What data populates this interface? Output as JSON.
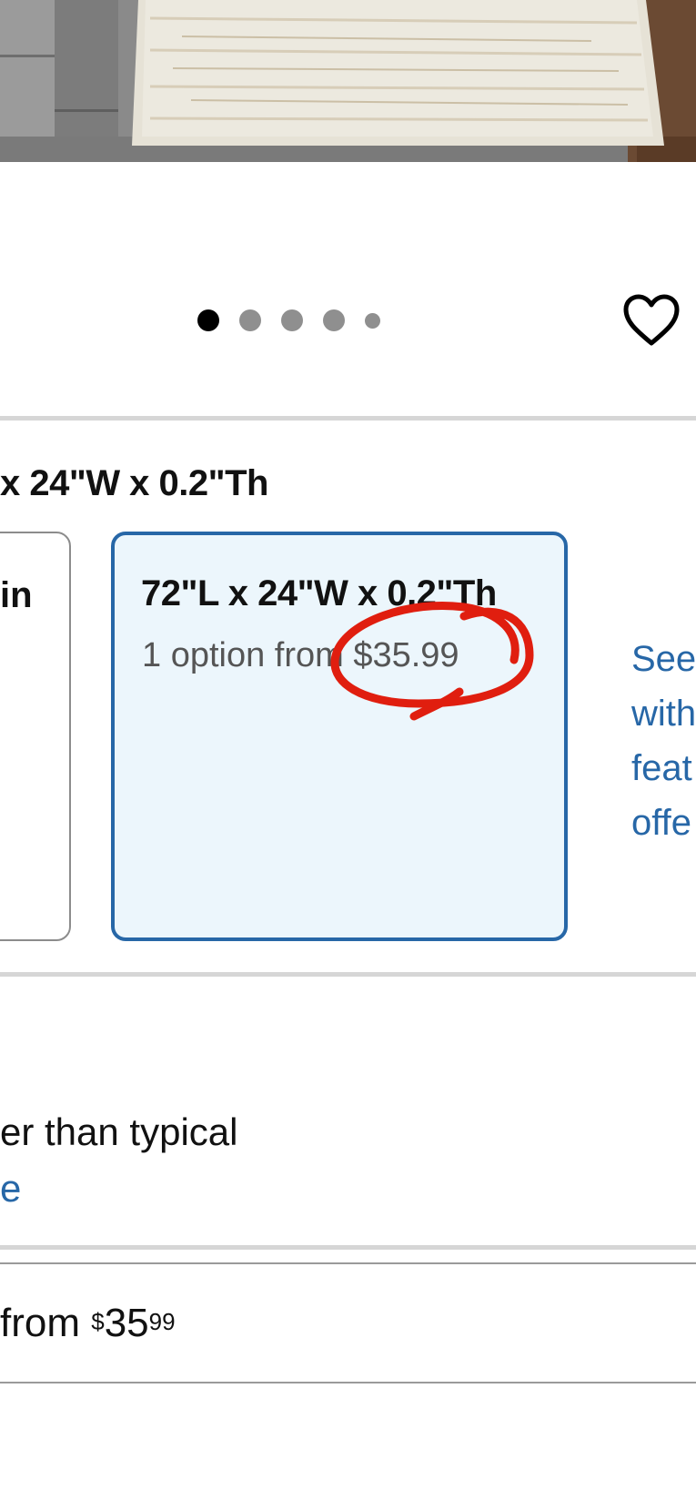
{
  "carousel": {
    "dots": [
      "active",
      "inactive",
      "inactive",
      "inactive",
      "small"
    ]
  },
  "favorite": {
    "icon": "heart-outline-icon"
  },
  "size_section": {
    "selected_size_title": "x 24\"W x 0.2\"Th",
    "left_card_label": "in",
    "selected_card": {
      "title": "72\"L x 24\"W x 0.2\"Th",
      "subtitle": "1 option from $35.99"
    },
    "see_link_lines": [
      "See",
      "with",
      "feat",
      "offe"
    ]
  },
  "savings": {
    "text": "er than typical",
    "link": "e"
  },
  "price_row": {
    "prefix": "from ",
    "currency": "$",
    "dollars": "35",
    "cents": "99"
  },
  "colors": {
    "accent_blue": "#2767a7",
    "selected_bg": "#ecf6fc",
    "annotation_red": "#e01e0f"
  }
}
